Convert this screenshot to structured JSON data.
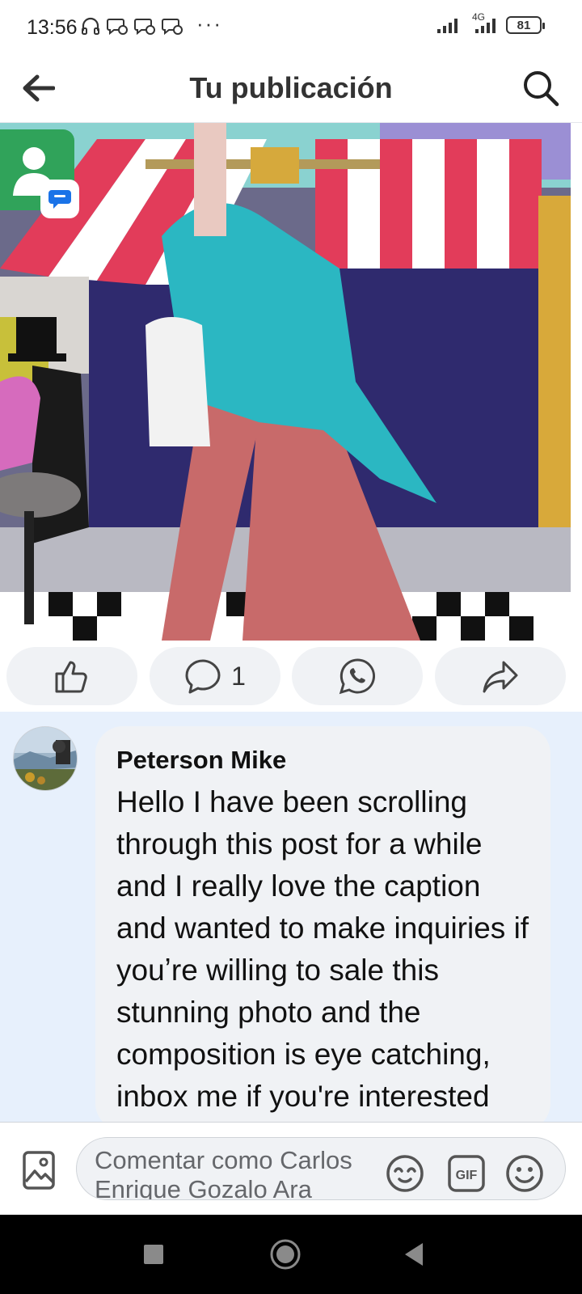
{
  "status_bar": {
    "time": "13:56",
    "network_label": "4G",
    "battery": "81",
    "more": "···"
  },
  "header": {
    "title": "Tu publicación"
  },
  "post": {
    "image_icons": [
      "person-icon",
      "chat-bubble-icon"
    ]
  },
  "actions": {
    "comment_count": "1"
  },
  "comment": {
    "author": "Peterson Mike",
    "text": "Hello I have been scrolling through this post for a while and I really love the caption and wanted to make inquiries if youʼre willing to sale this stunning photo and the composition is eye catching, inbox me if you're interested"
  },
  "composer": {
    "placeholder": "Comentar como Carlos Enrique Gozalo Ara"
  },
  "colors": {
    "accent_blue": "#1877f2",
    "comment_highlight": "#e7f0fc",
    "bubble": "#f0f2f5",
    "contact_green": "#30a35a"
  }
}
